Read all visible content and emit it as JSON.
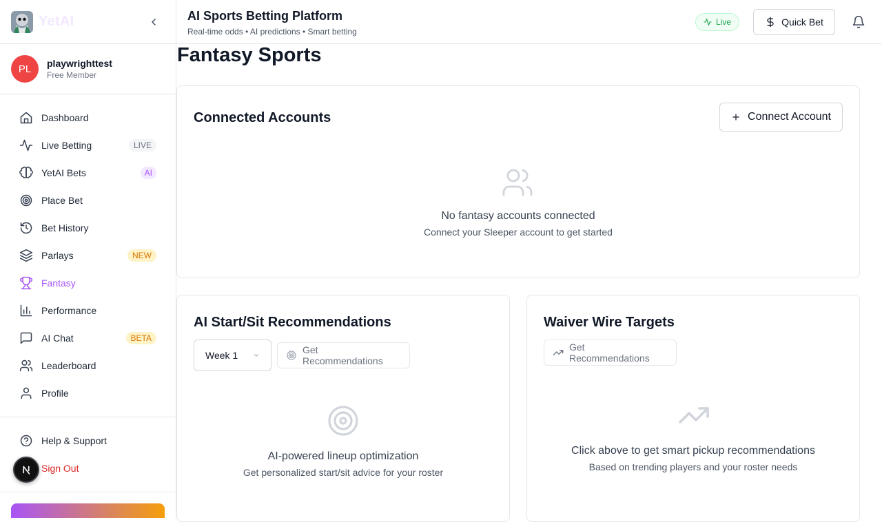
{
  "brand": {
    "name": "YetAI"
  },
  "user": {
    "initials": "PL",
    "name": "playwrighttest",
    "role": "Free Member"
  },
  "nav": {
    "items": [
      {
        "label": "Dashboard"
      },
      {
        "label": "Live Betting",
        "badge": "LIVE"
      },
      {
        "label": "YetAI Bets",
        "badge": "AI"
      },
      {
        "label": "Place Bet"
      },
      {
        "label": "Bet History"
      },
      {
        "label": "Parlays",
        "badge": "NEW"
      },
      {
        "label": "Fantasy"
      },
      {
        "label": "Performance"
      },
      {
        "label": "AI Chat",
        "badge": "BETA"
      },
      {
        "label": "Leaderboard"
      },
      {
        "label": "Profile"
      }
    ],
    "active": "Fantasy",
    "help": "Help & Support",
    "signout": "Sign Out"
  },
  "header": {
    "title": "AI Sports Betting Platform",
    "subtitle": "Real-time odds • AI predictions • Smart betting",
    "live_label": "Live",
    "quick_bet_label": "Quick Bet"
  },
  "page": {
    "title": "Fantasy Sports"
  },
  "connected": {
    "title": "Connected Accounts",
    "connect_button": "Connect Account",
    "empty_title": "No fantasy accounts connected",
    "empty_sub": "Connect your Sleeper account to get started"
  },
  "startsit": {
    "title": "AI Start/Sit Recommendations",
    "week_selected": "Week 1",
    "button": "Get Recommendations",
    "empty_title": "AI-powered lineup optimization",
    "empty_sub": "Get personalized start/sit advice for your roster"
  },
  "waiver": {
    "title": "Waiver Wire Targets",
    "button": "Get Recommendations",
    "empty_title": "Click above to get smart pickup recommendations",
    "empty_sub": "Based on trending players and your roster needs"
  },
  "colors": {
    "accent": "#a855f7",
    "live": "#16a34a",
    "danger": "#dc2626",
    "avatar": "#ef4444"
  }
}
